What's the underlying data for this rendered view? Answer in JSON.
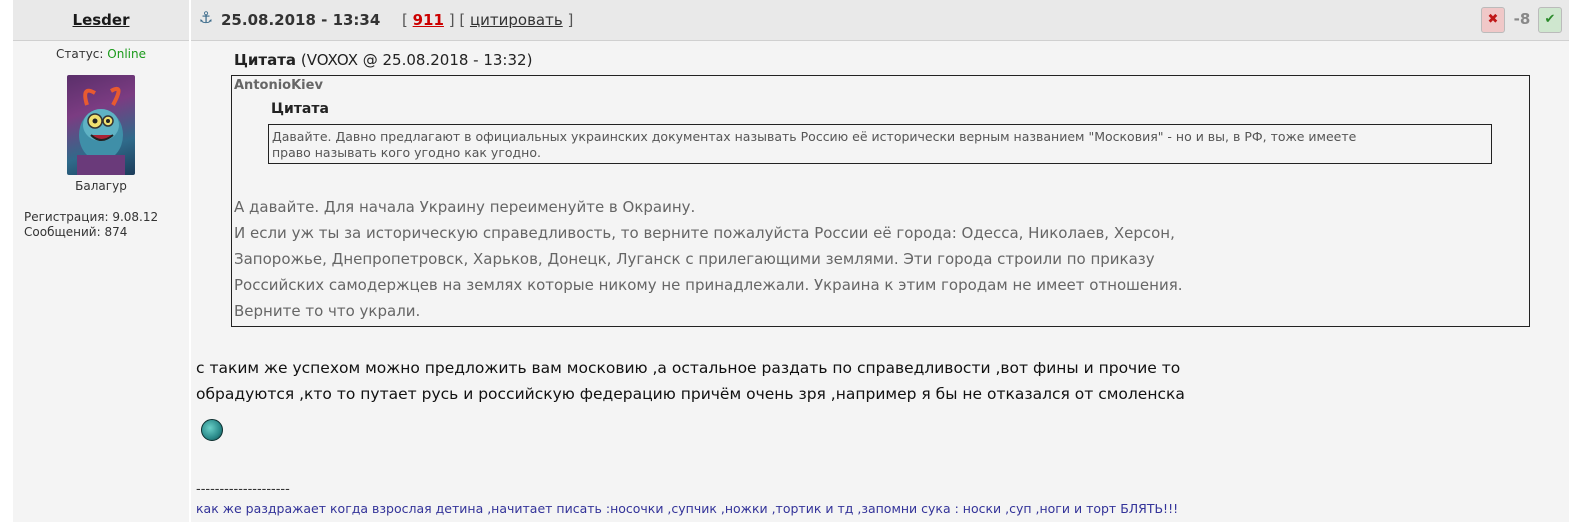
{
  "post": {
    "author": "Lesder",
    "date": "25.08.2018 - 13:34",
    "post_number": "911",
    "cite_label": "цитировать",
    "rating": "-8",
    "user": {
      "status_label": "Статус:",
      "status_value": "Online",
      "rank": "Балагур",
      "registration": "Регистрация: 9.08.12",
      "messages": "Сообщений: 874"
    },
    "quote_outer": {
      "label": "Цитата",
      "source": "(VOXOX @ 25.08.2018 - 13:32)",
      "author": "AntonioKiev",
      "inner_label": "Цитата",
      "inner_lines": [
        "Давайте. Давно предлагают в официальных украинских документах называть Россию её исторически верным названием \"Московия\" - но и вы, в РФ, тоже имеете",
        "право называть кого угодно как угодно."
      ],
      "lines": [
        "А давайте. Для начала Украину переименуйте в Окраину.",
        "И если уж ты за историческую справедливость, то верните пожалуйста России её города: Одесса, Николаев, Херсон,",
        "Запорожье, Днепропетровск, Харьков, Донецк, Луганск с прилегающими землями. Эти города строили по приказу",
        "Российских самодержцев на землях которые никому не принадлежали. Украина к этим городам не имеет отношения.",
        "Верните то что украли."
      ]
    },
    "body_lines": [
      "с таким же успехом можно предложить вам московию ,а остальное раздать по справедливости ,вот фины и прочие то",
      "обрадуются ,кто то путает русь и российскую федерацию причём очень зря ,например я бы не отказался от смоленска"
    ],
    "signature_separator": "--------------------",
    "signature": "как же раздражает когда взрослая детина ,начитает писать :носочки ,супчик ,ножки ,тортик и тд ,запомни сука : носки ,суп ,ноги и торт БЛЯТЬ!!!"
  },
  "icons": {
    "anchor": "anchor-icon",
    "thumb_down": "thumb-down-icon",
    "thumb_up": "thumb-up-icon",
    "smiley": "smiley-icon"
  }
}
